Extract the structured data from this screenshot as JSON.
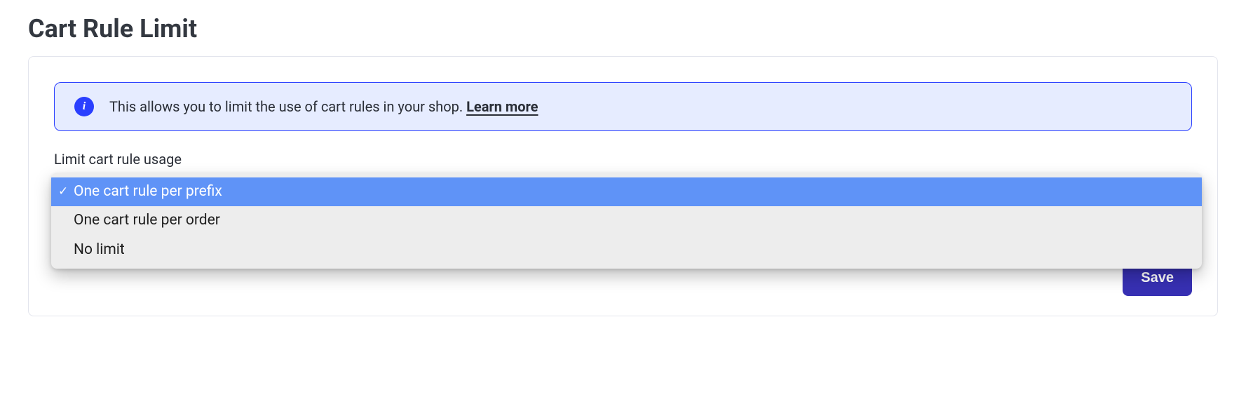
{
  "page": {
    "title": "Cart Rule Limit"
  },
  "alert": {
    "text": "This allows you to limit the use of cart rules in your shop. ",
    "link_label": "Learn more"
  },
  "field": {
    "label": "Limit cart rule usage"
  },
  "dropdown": {
    "options": [
      {
        "label": "One cart rule per prefix",
        "selected": true
      },
      {
        "label": "One cart rule per order",
        "selected": false
      },
      {
        "label": "No limit",
        "selected": false
      }
    ]
  },
  "actions": {
    "save_label": "Save"
  }
}
